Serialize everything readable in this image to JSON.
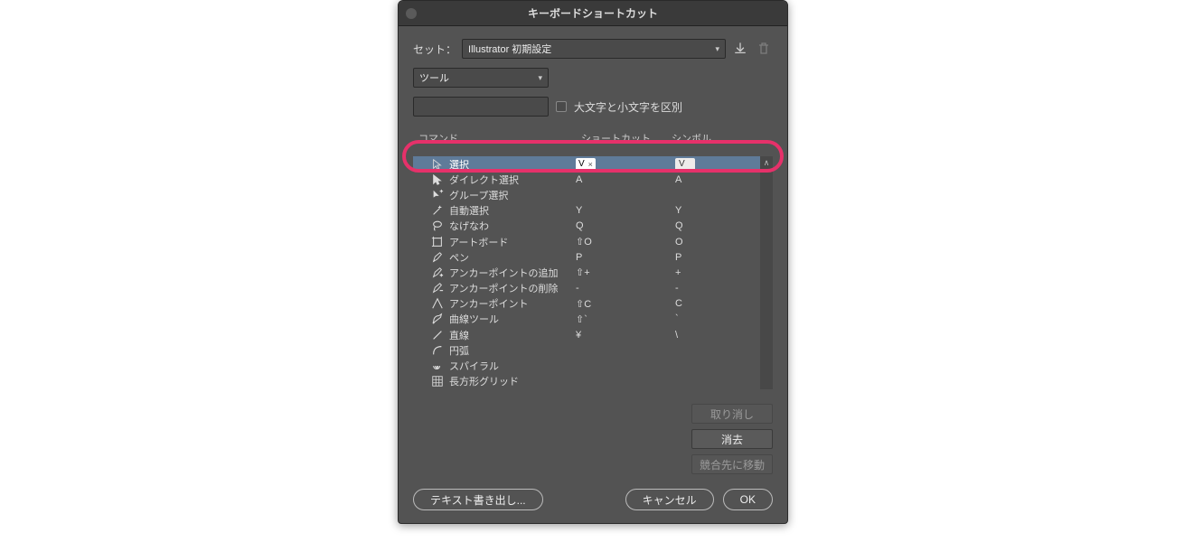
{
  "dialog": {
    "title": "キーボードショートカット",
    "set_label": "セット：",
    "set_value": "Illustrator 初期設定",
    "category_value": "ツール",
    "case_sensitive_label": "大文字と小文字を区別",
    "search_value": "",
    "columns": {
      "command": "コマンド",
      "shortcut": "ショートカット",
      "symbol": "シンボル"
    },
    "selected_edit": {
      "shortcut": "V",
      "clear_glyph": "×",
      "symbol": "V"
    },
    "rows": [
      {
        "name": "選択",
        "shortcut": "V",
        "symbol": "V",
        "selected": true
      },
      {
        "name": "ダイレクト選択",
        "shortcut": "A",
        "symbol": "A"
      },
      {
        "name": "グループ選択",
        "shortcut": "",
        "symbol": ""
      },
      {
        "name": "自動選択",
        "shortcut": "Y",
        "symbol": "Y"
      },
      {
        "name": "なげなわ",
        "shortcut": "Q",
        "symbol": "Q"
      },
      {
        "name": "アートボード",
        "shortcut": "⇧O",
        "symbol": "O"
      },
      {
        "name": "ペン",
        "shortcut": "P",
        "symbol": "P"
      },
      {
        "name": "アンカーポイントの追加",
        "shortcut": "⇧+",
        "symbol": "+"
      },
      {
        "name": "アンカーポイントの削除",
        "shortcut": "-",
        "symbol": "-"
      },
      {
        "name": "アンカーポイント",
        "shortcut": "⇧C",
        "symbol": "C"
      },
      {
        "name": "曲線ツール",
        "shortcut": "⇧`",
        "symbol": "`"
      },
      {
        "name": "直線",
        "shortcut": "¥",
        "symbol": "\\"
      },
      {
        "name": "円弧",
        "shortcut": "",
        "symbol": ""
      },
      {
        "name": "スパイラル",
        "shortcut": "",
        "symbol": ""
      },
      {
        "name": "長方形グリッド",
        "shortcut": "",
        "symbol": ""
      }
    ],
    "buttons": {
      "undo": "取り消し",
      "clear": "消去",
      "go_conflict": "競合先に移動",
      "export": "テキスト書き出し...",
      "cancel": "キャンセル",
      "ok": "OK"
    },
    "icons": {
      "save": "save-icon",
      "trash": "trash-icon",
      "search": "search-icon"
    }
  }
}
